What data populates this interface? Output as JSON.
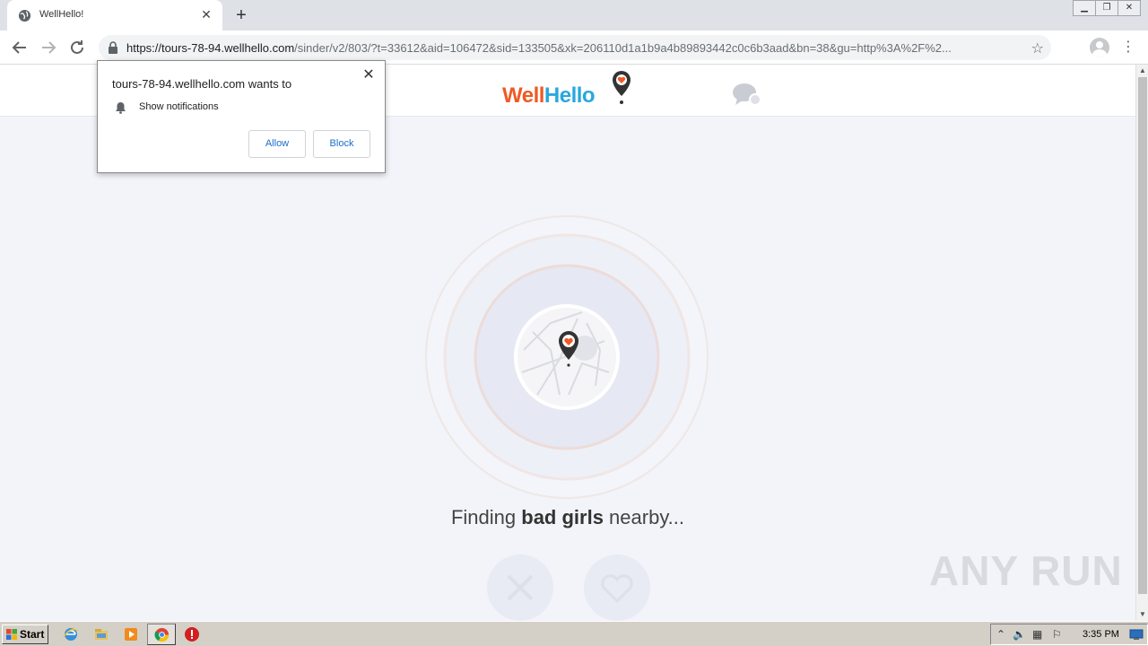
{
  "browser": {
    "tab_title": "WellHello!",
    "url_host": "https://tours-78-94.wellhello.com",
    "url_rest": "/sinder/v2/803/?t=33612&aid=106472&sid=133505&xk=206110d1a1b9a4b89893442c0c6b3aad&bn=38&gu=http%3A%2F%2...",
    "new_tab_glyph": "+",
    "close_glyph": "✕"
  },
  "popup": {
    "title": "tours-78-94.wellhello.com wants to",
    "permission": "Show notifications",
    "allow_label": "Allow",
    "block_label": "Block"
  },
  "site": {
    "logo_part1": "Well",
    "logo_part2": "Hello",
    "finding_prefix": "Finding ",
    "finding_bold": "bad girls",
    "finding_suffix": " nearby...",
    "brand_orange": "#ef5a24",
    "brand_blue": "#2aa7de"
  },
  "watermark": "ANY RUN",
  "taskbar": {
    "start_label": "Start",
    "clock": "3:35 PM"
  }
}
